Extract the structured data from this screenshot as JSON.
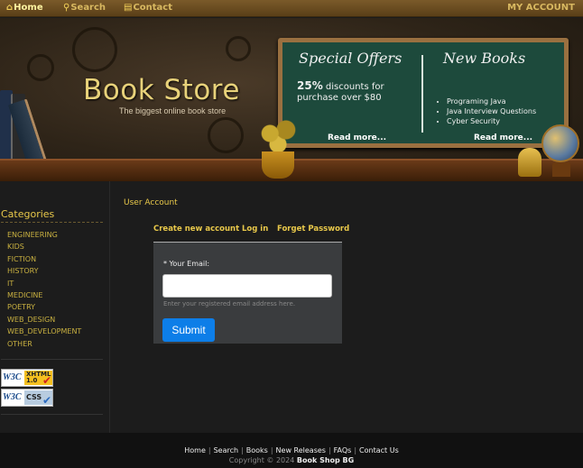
{
  "nav": {
    "home_icon": "house-icon",
    "home": "Home",
    "search_icon": "search-icon",
    "search": "Search",
    "contact_icon": "book-icon",
    "contact": "Contact",
    "account": "MY ACCOUNT"
  },
  "banner": {
    "title": "Book Store",
    "tagline": "The biggest online book store",
    "offers": {
      "title": "Special Offers",
      "percent": "25%",
      "text": "discounts for purchase over $80",
      "more": "Read more..."
    },
    "new_books": {
      "title": "New Books",
      "items": [
        "Programing Java",
        "Java Interview Questions",
        "Cyber Security"
      ],
      "more": "Read more..."
    }
  },
  "sidebar": {
    "title": "Categories",
    "categories": [
      "ENGINEERING",
      "KIDS",
      "FICTION",
      "HISTORY",
      "IT",
      "MEDICINE",
      "POETRY",
      "WEB_DESIGN",
      "WEB_DEVELOPMENT",
      "OTHER"
    ],
    "badges": {
      "xhtml_logo": "W3C",
      "xhtml_label": "XHTML 1.0",
      "css_logo": "W3C",
      "css_label": "CSS"
    }
  },
  "main": {
    "heading": "User Account",
    "tabs": [
      "Create new account",
      "Log in",
      "Forget Password"
    ],
    "form": {
      "email_label": "* Your Email:",
      "email_value": "",
      "email_help": "Enter your registered email address here.",
      "submit": "Submit"
    }
  },
  "footer": {
    "links": [
      "Home",
      "Search",
      "Books",
      "New Releases",
      "FAQs",
      "Contact Us"
    ],
    "copyright_prefix": "Copyright © 2024",
    "copyright_brand": "Book Shop BG"
  },
  "colors": {
    "accent": "#e8c84a",
    "submit": "#0d7ee8",
    "board": "#1d4a3c"
  }
}
